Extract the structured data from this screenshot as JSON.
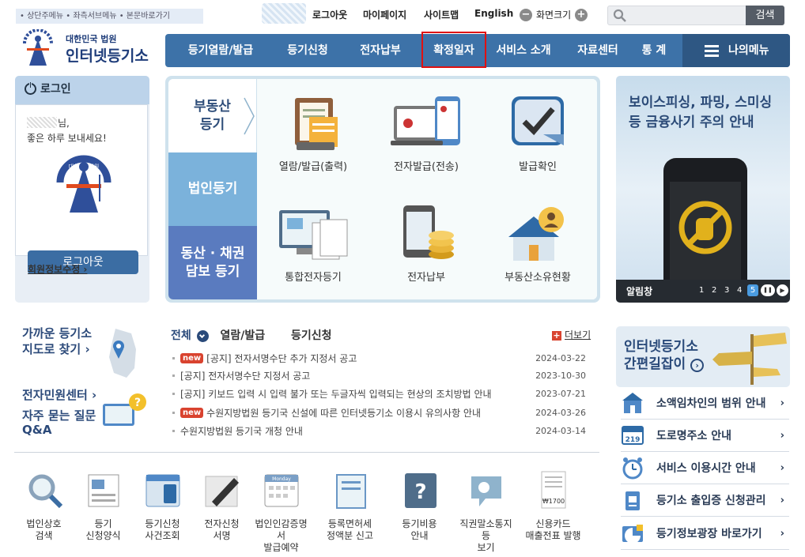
{
  "skip_links": "• 상단주메뉴 • 좌측서브메뉴 • 본문바로가기",
  "top": {
    "logout": "로그아웃",
    "mypage": "마이페이지",
    "sitemap": "사이트맵",
    "english": "English",
    "zoom": "화면크기",
    "zoom_minus": "−",
    "zoom_plus": "+",
    "search_button": "검색",
    "search_placeholder": ""
  },
  "logo": {
    "small": "대한민국 법원",
    "big": "인터넷등기소"
  },
  "nav": {
    "items": [
      "등기열람/발급",
      "등기신청",
      "전자납부",
      "확정일자",
      "서비스 소개",
      "자료센터",
      "통 계"
    ],
    "my_menu": "나의메뉴"
  },
  "login": {
    "title": "로그인",
    "greeting_suffix": "님,",
    "greeting": "좋은 하루 보내세요!",
    "emblem": "대한민국법원",
    "logout_button": "로그아웃",
    "member_link": "회원정보수정 ›"
  },
  "hub": {
    "tabs": [
      {
        "l1": "부동산",
        "l2": "등기"
      },
      {
        "l1": "법인등기",
        "l2": ""
      },
      {
        "l1": "동산 · 채권",
        "l2": "담보 등기"
      }
    ],
    "services": [
      "열람/발급(출력)",
      "전자발급(전송)",
      "발급확인",
      "통합전자등기",
      "전자납부",
      "부동산소유현황"
    ]
  },
  "banner": {
    "line1": "보이스피싱, 파밍, 스미싱",
    "line2": "등 금융사기 주의 안내",
    "label": "알림창",
    "pages": [
      "1",
      "2",
      "3",
      "4",
      "5"
    ],
    "pause": "❚❚",
    "next": "▶"
  },
  "left": {
    "near1": "가까운 등기소",
    "near2": "지도로 찾기",
    "civil": "전자민원센터",
    "faq1": "자주 묻는 질문",
    "faq2": "Q&A"
  },
  "notice": {
    "tab_all": "전체",
    "tab2": "열람/발급",
    "tab3": "등기신청",
    "more": "더보기",
    "plus": "+",
    "new_label": "new",
    "rows": [
      {
        "new": true,
        "title": "[공지] 전자서명수단 추가 지정서 공고",
        "date": "2024-03-22"
      },
      {
        "new": false,
        "title": "[공지] 전자서명수단 지정서 공고",
        "date": "2023-10-30"
      },
      {
        "new": false,
        "title": "[공지] 키보드 입력 시 입력 불가 또는 두글자씩 입력되는 현상의 조치방법 안내",
        "date": "2023-07-21"
      },
      {
        "new": true,
        "title": "수원지방법원 등기국 신설에 따른 인터넷등기소 이용시 유의사항 안내",
        "date": "2024-03-26"
      },
      {
        "new": false,
        "title": "수원지방법원 등기국 개청 안내",
        "date": "2024-03-14"
      }
    ]
  },
  "quick": [
    {
      "l1": "법인상호",
      "l2": "검색"
    },
    {
      "l1": "등기",
      "l2": "신청양식"
    },
    {
      "l1": "등기신청",
      "l2": "사건조회"
    },
    {
      "l1": "전자신청",
      "l2": "서명"
    },
    {
      "l1": "법인인감증명서",
      "l2": "발급예약"
    },
    {
      "l1": "등록면허세",
      "l2": "정액분 신고"
    },
    {
      "l1": "등기비용",
      "l2": "안내"
    },
    {
      "l1": "직권말소통지등",
      "l2": "보기"
    },
    {
      "l1": "신용카드",
      "l2": "매출전표 발행"
    }
  ],
  "quick_glyphs": {
    "calendar": "Monday",
    "receipt": "₩1700",
    "qmark": "?"
  },
  "guide": {
    "l1": "인터넷등기소",
    "l2": "간편길잡이"
  },
  "links": [
    "소액임차인의 범위 안내",
    "도로명주소 안내",
    "서비스 이용시간 안내",
    "등기소 출입증 신청관리",
    "등기정보광장 바로가기"
  ],
  "road_sign": "219",
  "arrow": "›",
  "colors": {
    "nav": "#3d72a8",
    "accent_red": "#e01010",
    "new_badge": "#d9432f"
  }
}
